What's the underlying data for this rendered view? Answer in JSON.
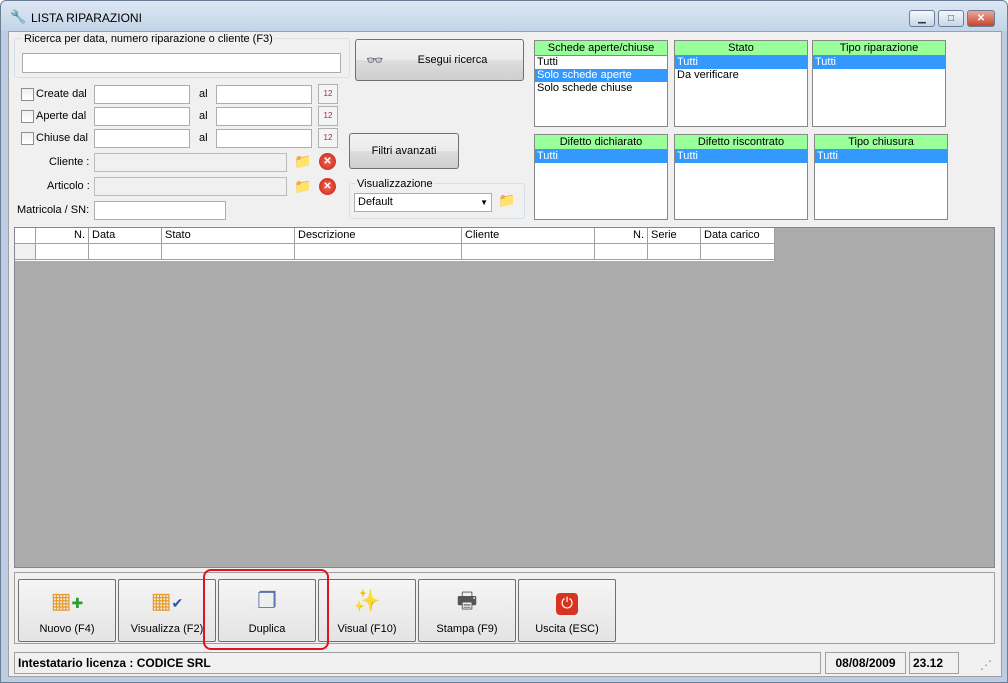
{
  "window": {
    "title": "LISTA RIPARAZIONI"
  },
  "search": {
    "group_label": "Ricerca per data, numero riparazione o cliente (F3)",
    "value": "",
    "button": "Esegui ricerca"
  },
  "date_filters": [
    {
      "label": "Create dal",
      "al": "al"
    },
    {
      "label": "Aperte dal",
      "al": "al"
    },
    {
      "label": "Chiuse dal",
      "al": "al"
    }
  ],
  "fields": {
    "cliente": "Cliente :",
    "articolo": "Articolo :",
    "matricola": "Matricola / SN:"
  },
  "advanced_button": "Filtri avanzati",
  "visualizzazione": {
    "label": "Visualizzazione",
    "selected": "Default"
  },
  "filter_lists": [
    {
      "header": "Schede aperte/chiuse",
      "items": [
        "Tutti",
        "Solo schede aperte",
        "Solo schede chiuse"
      ],
      "selected": 1
    },
    {
      "header": "Stato",
      "items": [
        "Tutti",
        "Da verificare"
      ],
      "selected": 0
    },
    {
      "header": "Tipo riparazione",
      "items": [
        "Tutti"
      ],
      "selected": 0
    },
    {
      "header": "Difetto dichiarato",
      "items": [
        "Tutti"
      ],
      "selected": 0
    },
    {
      "header": "Difetto riscontrato",
      "items": [
        "Tutti"
      ],
      "selected": 0
    },
    {
      "header": "Tipo chiusura",
      "items": [
        "Tutti"
      ],
      "selected": 0
    }
  ],
  "grid": {
    "columns": [
      "N.",
      "Data",
      "Stato",
      "Descrizione",
      "Cliente",
      "N.",
      "Serie",
      "Data carico"
    ]
  },
  "toolbar": {
    "buttons": [
      {
        "label": "Nuovo (F4)",
        "icon": "grid-add-icon"
      },
      {
        "label": "Visualizza (F2)",
        "icon": "grid-check-icon"
      },
      {
        "label": "Duplica",
        "icon": "duplicate-icon"
      },
      {
        "label": "Visual (F10)",
        "icon": "magic-wand-icon"
      },
      {
        "label": "Stampa (F9)",
        "icon": "printer-icon"
      },
      {
        "label": "Uscita (ESC)",
        "icon": "power-icon"
      }
    ]
  },
  "status": {
    "license": "Intestatario licenza : CODICE SRL",
    "date": "08/08/2009",
    "time": "23.12"
  },
  "colors": {
    "filter_header": "#99ff99",
    "selection": "#3399ff",
    "highlight_box": "#e0141e"
  }
}
